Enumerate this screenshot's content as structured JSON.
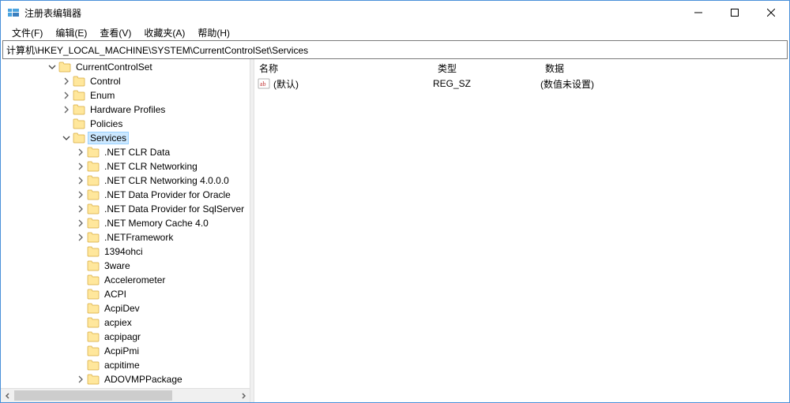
{
  "window": {
    "title": "注册表编辑器"
  },
  "menu": {
    "file": "文件(F)",
    "edit": "编辑(E)",
    "view": "查看(V)",
    "favorites": "收藏夹(A)",
    "help": "帮助(H)"
  },
  "address": {
    "path": "计算机\\HKEY_LOCAL_MACHINE\\SYSTEM\\CurrentControlSet\\Services"
  },
  "tree": {
    "nodes": [
      {
        "indent": 57,
        "expander": "down",
        "label": "CurrentControlSet",
        "selected": false
      },
      {
        "indent": 75,
        "expander": "right",
        "label": "Control",
        "selected": false
      },
      {
        "indent": 75,
        "expander": "right",
        "label": "Enum",
        "selected": false
      },
      {
        "indent": 75,
        "expander": "right",
        "label": "Hardware Profiles",
        "selected": false
      },
      {
        "indent": 75,
        "expander": "none",
        "label": "Policies",
        "selected": false
      },
      {
        "indent": 75,
        "expander": "down",
        "label": "Services",
        "selected": true
      },
      {
        "indent": 93,
        "expander": "right",
        "label": ".NET CLR Data",
        "selected": false
      },
      {
        "indent": 93,
        "expander": "right",
        "label": ".NET CLR Networking",
        "selected": false
      },
      {
        "indent": 93,
        "expander": "right",
        "label": ".NET CLR Networking 4.0.0.0",
        "selected": false
      },
      {
        "indent": 93,
        "expander": "right",
        "label": ".NET Data Provider for Oracle",
        "selected": false
      },
      {
        "indent": 93,
        "expander": "right",
        "label": ".NET Data Provider for SqlServer",
        "selected": false
      },
      {
        "indent": 93,
        "expander": "right",
        "label": ".NET Memory Cache 4.0",
        "selected": false
      },
      {
        "indent": 93,
        "expander": "right",
        "label": ".NETFramework",
        "selected": false
      },
      {
        "indent": 93,
        "expander": "none",
        "label": "1394ohci",
        "selected": false
      },
      {
        "indent": 93,
        "expander": "none",
        "label": "3ware",
        "selected": false
      },
      {
        "indent": 93,
        "expander": "none",
        "label": "Accelerometer",
        "selected": false
      },
      {
        "indent": 93,
        "expander": "none",
        "label": "ACPI",
        "selected": false
      },
      {
        "indent": 93,
        "expander": "none",
        "label": "AcpiDev",
        "selected": false
      },
      {
        "indent": 93,
        "expander": "none",
        "label": "acpiex",
        "selected": false
      },
      {
        "indent": 93,
        "expander": "none",
        "label": "acpipagr",
        "selected": false
      },
      {
        "indent": 93,
        "expander": "none",
        "label": "AcpiPmi",
        "selected": false
      },
      {
        "indent": 93,
        "expander": "none",
        "label": "acpitime",
        "selected": false
      },
      {
        "indent": 93,
        "expander": "right",
        "label": "ADOVMPPackage",
        "selected": false
      }
    ]
  },
  "list": {
    "columns": {
      "name": "名称",
      "type": "类型",
      "data": "数据"
    },
    "rows": [
      {
        "icon": "sz",
        "name": "(默认)",
        "type": "REG_SZ",
        "data": "(数值未设置)"
      }
    ]
  }
}
